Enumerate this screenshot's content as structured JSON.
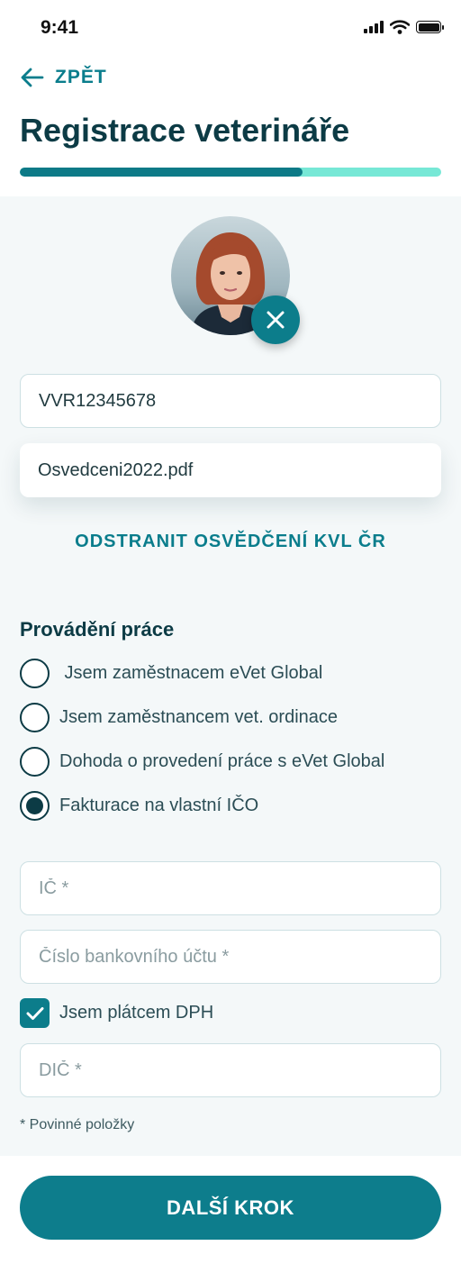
{
  "status_bar": {
    "time": "9:41"
  },
  "nav": {
    "back_label": "ZPĚT"
  },
  "page": {
    "title": "Registrace veterináře"
  },
  "progress": {
    "value": 0.67
  },
  "form": {
    "registration_number": "VVR12345678",
    "certificate_file": "Osvedceni2022.pdf",
    "remove_certificate_label": "ODSTRANIT OSVĚDČENÍ KVL ČR",
    "work_section_title": "Provádění práce",
    "work_options": [
      {
        "label": " Jsem zaměstnacem eVet Global",
        "selected": false
      },
      {
        "label": "Jsem zaměstnancem vet. ordinace",
        "selected": false
      },
      {
        "label": "Dohoda o provedení práce s eVet Global",
        "selected": false
      },
      {
        "label": "Fakturace na vlastní IČO",
        "selected": true
      }
    ],
    "ico_placeholder": "IČ *",
    "bank_account_placeholder": "Číslo bankovního účtu *",
    "vat_payer_label": "Jsem plátcem DPH",
    "vat_payer_checked": true,
    "dic_placeholder": "DIČ *",
    "required_note": "* Povinné položky"
  },
  "footer": {
    "next_button_label": "DALŠÍ KROK"
  },
  "colors": {
    "accent": "#0a7d8c",
    "primary_dark": "#0c3b45",
    "progress_track": "#77e8d6",
    "background": "#f4f8f9"
  },
  "icons": [
    "signal-icon",
    "wifi-icon",
    "battery-icon",
    "back-arrow-icon",
    "close-icon",
    "checkmark-icon"
  ]
}
